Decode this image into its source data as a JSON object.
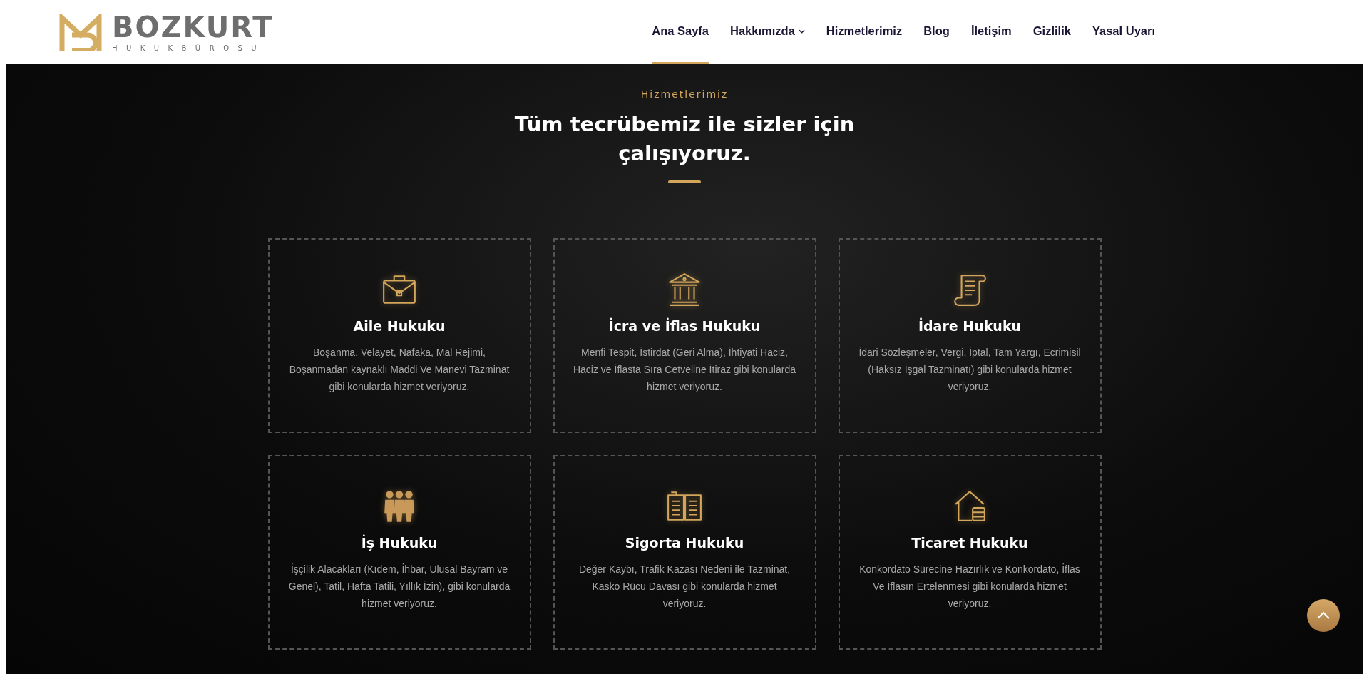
{
  "header": {
    "logo": {
      "name": "BOZKURT",
      "tagline": "HUKUKBÜROSU"
    },
    "nav": [
      {
        "label": "Ana Sayfa",
        "selected": true,
        "has_dropdown": false
      },
      {
        "label": "Hakkımızda",
        "selected": false,
        "has_dropdown": true
      },
      {
        "label": "Hizmetlerimiz",
        "selected": false,
        "has_dropdown": false
      },
      {
        "label": "Blog",
        "selected": false,
        "has_dropdown": false
      },
      {
        "label": "İletişim",
        "selected": false,
        "has_dropdown": false
      },
      {
        "label": "Gizlilik",
        "selected": false,
        "has_dropdown": false
      },
      {
        "label": "Yasal Uyarı",
        "selected": false,
        "has_dropdown": false
      }
    ]
  },
  "services": {
    "eyebrow": "Hizmetlerimiz",
    "heading": "Tüm tecrübemiz ile sizler için çalışıyoruz.",
    "cards": [
      {
        "title": "Aile Hukuku",
        "text": "Boşanma, Velayet, Nafaka, Mal Rejimi, Boşanmadan kaynaklı Maddi Ve Manevi Tazminat gibi konularda hizmet veriyoruz."
      },
      {
        "title": "İcra ve İflas Hukuku",
        "text": "Menfi Tespit, İstirdat (Geri Alma), İhtiyati Haciz, Haciz ve İflasta Sıra Cetveline İtiraz gibi konularda hizmet veriyoruz."
      },
      {
        "title": "İdare Hukuku",
        "text": "İdari Sözleşmeler, Vergi, İptal, Tam Yargı, Ecrimisil (Haksız İşgal Tazminatı) gibi konularda hizmet veriyoruz."
      },
      {
        "title": "İş Hukuku",
        "text": "İşçilik Alacakları (Kıdem, İhbar, Ulusal Bayram ve Genel), Tatil, Hafta Tatili, Yıllık İzin), gibi konularda hizmet veriyoruz."
      },
      {
        "title": "Sigorta Hukuku",
        "text": "Değer Kaybı, Trafik Kazası Nedeni ile Tazminat, Kasko Rücu Davası gibi konularda hizmet veriyoruz."
      },
      {
        "title": "Ticaret Hukuku",
        "text": "Konkordato Sürecine Hazırlık ve Konkordato, İflas Ve İflasın Ertelenmesi gibi konularda hizmet veriyoruz."
      }
    ]
  }
}
